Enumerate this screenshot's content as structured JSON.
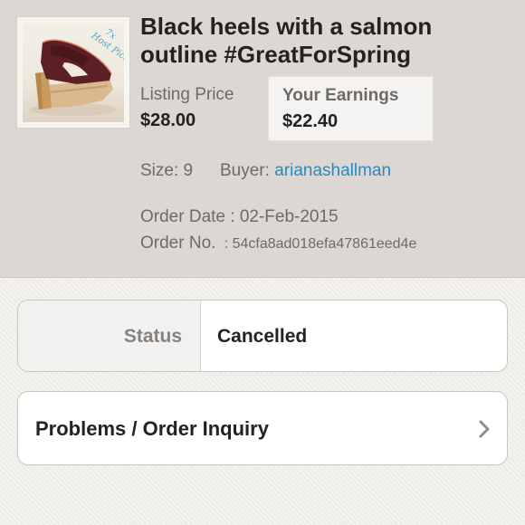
{
  "listing": {
    "title": "Black heels with a salmon outline #GreatForSpring",
    "thumbnail_icon": "shoe-thumbnail",
    "thumbnail_badge": "7x Host Pick"
  },
  "pricing": {
    "listing_price_label": "Listing Price",
    "listing_price_value": "$28.00",
    "earnings_label": "Your Earnings",
    "earnings_value": "$22.40"
  },
  "details": {
    "size_label": "Size: 9",
    "buyer_label": "Buyer:",
    "buyer_name": "arianashallman",
    "order_date_label": "Order Date : 02-Feb-2015",
    "order_no_label": "Order No.",
    "order_no_value": ": 54cfa8ad018efa47861eed4e"
  },
  "status": {
    "label": "Status",
    "value": "Cancelled"
  },
  "inquiry": {
    "label": "Problems / Order Inquiry",
    "icon": "chevron-right-icon"
  },
  "colors": {
    "header_bg": "#dcd7d2",
    "link": "#2a8abf",
    "badge": "#4aa7c9"
  }
}
